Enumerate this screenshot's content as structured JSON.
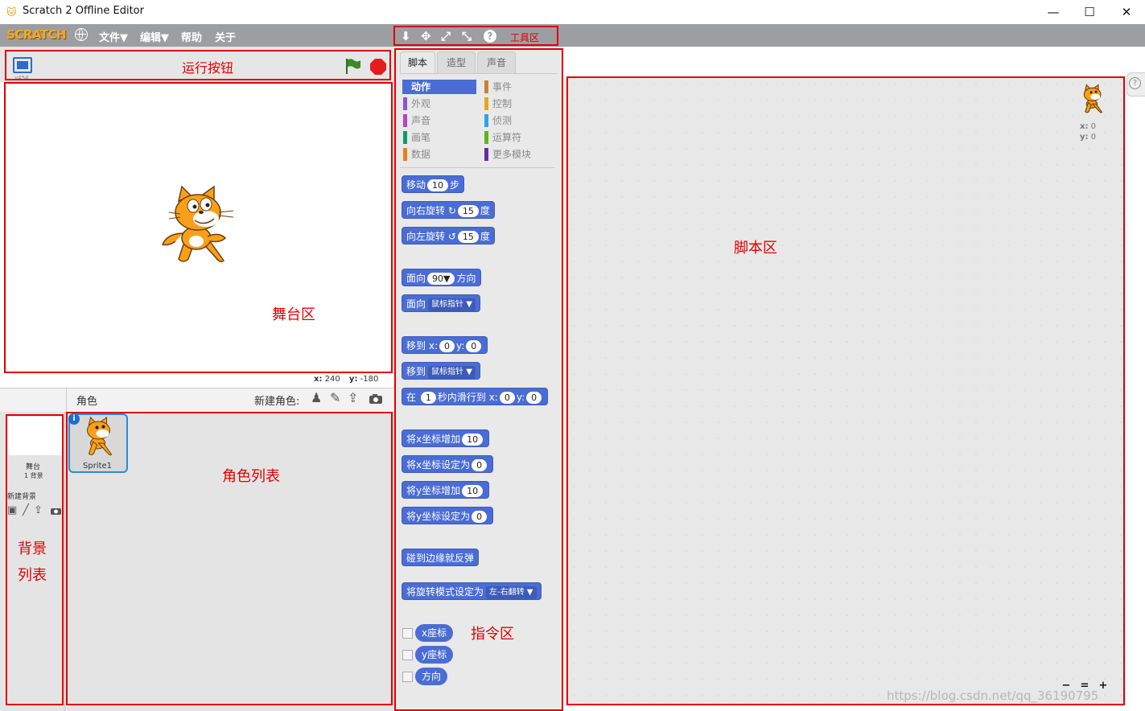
{
  "window": {
    "title": "Scratch 2 Offline Editor",
    "minimize": "—",
    "maximize": "☐",
    "close": "✕"
  },
  "menubar": {
    "logo": "SCRATCH",
    "menus": [
      "文件▼",
      "编辑▼",
      "帮助",
      "关于"
    ],
    "tools": [
      "⬇",
      "✥",
      "⤢",
      "⤡",
      "?"
    ],
    "tools_label": "工具区"
  },
  "stage": {
    "header_label": "运行按钮",
    "version": "v454",
    "stage_label": "舞台区",
    "coord_x_label": "x:",
    "coord_x_value": "240",
    "coord_y_label": "y:",
    "coord_y_value": "-180"
  },
  "sprites": {
    "header_title": "角色",
    "new_sprite_label": "新建角色:",
    "stage_thumb_label": "舞台",
    "stage_thumb_count": "1 背景",
    "new_backdrop_label": "新建背景",
    "sprite_name": "Sprite1",
    "list_label": "角色列表",
    "backdrop_label_line1": "背景",
    "backdrop_label_line2": "列表"
  },
  "palette": {
    "tabs": [
      "脚本",
      "造型",
      "声音"
    ],
    "categories_left": [
      "动作",
      "外观",
      "声音",
      "画笔",
      "数据"
    ],
    "categories_right": [
      "事件",
      "控制",
      "侦测",
      "运算符",
      "更多模块"
    ],
    "category_colors": {
      "motion": "#4a6cd4",
      "looks": "#8a55d7",
      "sound": "#bb42c3",
      "pen": "#0e9a6c",
      "data": "#ee7d16",
      "events": "#c88330",
      "control": "#e1a91a",
      "sensing": "#2ca5e2",
      "operators": "#5cb712",
      "more": "#632d99"
    },
    "blocks": {
      "move": {
        "a": "移动",
        "v": "10",
        "b": "步"
      },
      "turn_right": {
        "a": "向右旋转",
        "icon": "↻",
        "v": "15",
        "b": "度"
      },
      "turn_left": {
        "a": "向左旋转",
        "icon": "↺",
        "v": "15",
        "b": "度"
      },
      "point_dir": {
        "a": "面向",
        "v": "90▼",
        "b": "方向"
      },
      "point_towards": {
        "a": "面向",
        "d": "鼠标指针 ▼"
      },
      "goto_xy": {
        "a": "移到",
        "x": "x:",
        "xv": "0",
        "y": "y:",
        "yv": "0"
      },
      "goto": {
        "a": "移到",
        "d": "鼠标指针 ▼"
      },
      "glide": {
        "a": "在",
        "v": "1",
        "b": "秒内滑行到",
        "x": "x:",
        "xv": "0",
        "y": "y:",
        "yv": "0"
      },
      "change_x": {
        "a": "将x坐标增加",
        "v": "10"
      },
      "set_x": {
        "a": "将x坐标设定为",
        "v": "0"
      },
      "change_y": {
        "a": "将y坐标增加",
        "v": "10"
      },
      "set_y": {
        "a": "将y坐标设定为",
        "v": "0"
      },
      "bounce": {
        "a": "碰到边缘就反弹"
      },
      "rotation_style": {
        "a": "将旋转模式设定为",
        "d": "左-右翻转 ▼"
      }
    },
    "reporters": [
      "x座标",
      "y座标",
      "方向"
    ],
    "area_label": "指令区"
  },
  "scripts": {
    "area_label": "脚本区",
    "x_label": "x:",
    "x_value": "0",
    "y_label": "y:",
    "y_value": "0",
    "help": "?",
    "zoom_out": "−",
    "zoom_reset": "=",
    "zoom_in": "+",
    "watermark": "https://blog.csdn.net/qq_36190795"
  }
}
